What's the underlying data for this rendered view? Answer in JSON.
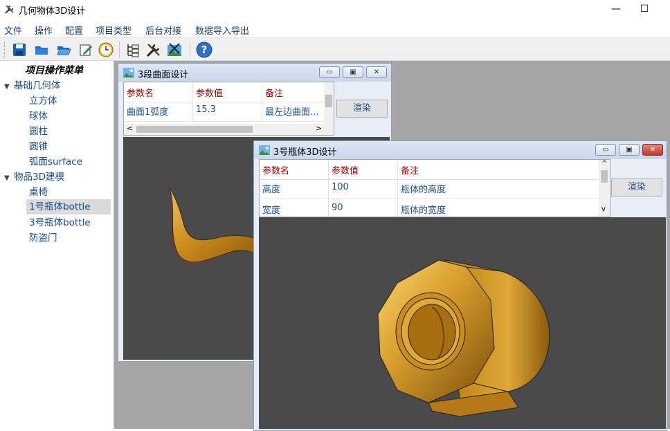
{
  "window": {
    "title": "几何物体3D设计",
    "minimize": "—",
    "maximize": "☐"
  },
  "menu": [
    "文件",
    "操作",
    "配置",
    "项目类型",
    "后台对接",
    "数据导入导出"
  ],
  "toolbar": {
    "icons": [
      "save-icon",
      "folder-icon",
      "open-folder-icon",
      "edit-icon",
      "clock-icon",
      "tree-view-icon",
      "tools-icon",
      "picture-tools-icon",
      "help-icon"
    ],
    "help_glyph": "?"
  },
  "sidebar": {
    "header": "项目操作菜单",
    "groups": [
      {
        "label": "基础几何体",
        "arrow": "▼",
        "items": [
          "立方体",
          "球体",
          "圆柱",
          "圆锥",
          "弧面surface"
        ]
      },
      {
        "label": "物品3D建模",
        "arrow": "▼",
        "items": [
          "桌椅",
          "1号瓶体bottle",
          "3号瓶体bottle",
          "防盗门"
        ]
      }
    ],
    "selected": "1号瓶体bottle"
  },
  "window1": {
    "title": "3段曲面设计",
    "columns": [
      "参数名",
      "参数值",
      "备注"
    ],
    "rows": [
      [
        "曲面1弧度",
        "15.3",
        "最左边曲面..."
      ]
    ],
    "render_button": "渲染",
    "scroll_left": "<",
    "scroll_right": ">"
  },
  "window2": {
    "title": "3号瓶体3D设计",
    "columns": [
      "参数名",
      "参数值",
      "备注"
    ],
    "rows": [
      [
        "高度",
        "100",
        "瓶体的高度"
      ],
      [
        "宽度",
        "90",
        "瓶体的宽度"
      ]
    ],
    "render_button": "渲染",
    "scroll_up": "^",
    "scroll_down": "v"
  },
  "window_buttons": {
    "minimize": "▭",
    "restore": "▣",
    "close": "✕"
  },
  "colors": {
    "header_text": "#b00000",
    "value_text": "#1a4d8f",
    "viewport_bg": "#4a4a4a",
    "model_gold": "#d39a2a"
  }
}
